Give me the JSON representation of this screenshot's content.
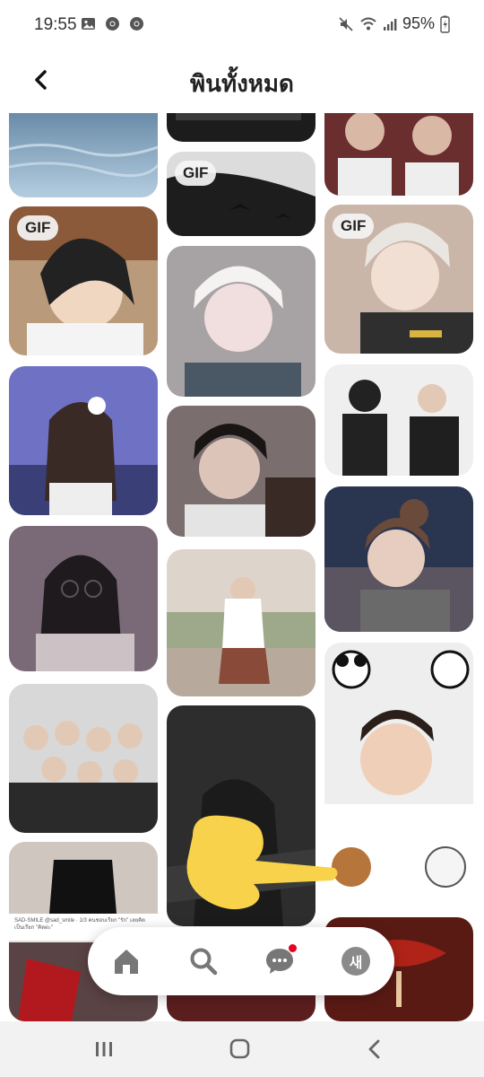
{
  "status_bar": {
    "time": "19:55",
    "battery": "95%"
  },
  "header": {
    "title": "พินทั้งหมด"
  },
  "pins": {
    "gif_label": "GIF",
    "tweet_caption": "SAD-SMILE @sad_smile · 1/3\nคนชอบเรียก \"รัก\" เลยคิดเป็นเรียก \"คิดผ่ะ\""
  },
  "bottom_nav": {
    "profile_initial": "새"
  },
  "colors": {
    "notification": "#e60023",
    "overlay_hand": "#f7d24a"
  }
}
